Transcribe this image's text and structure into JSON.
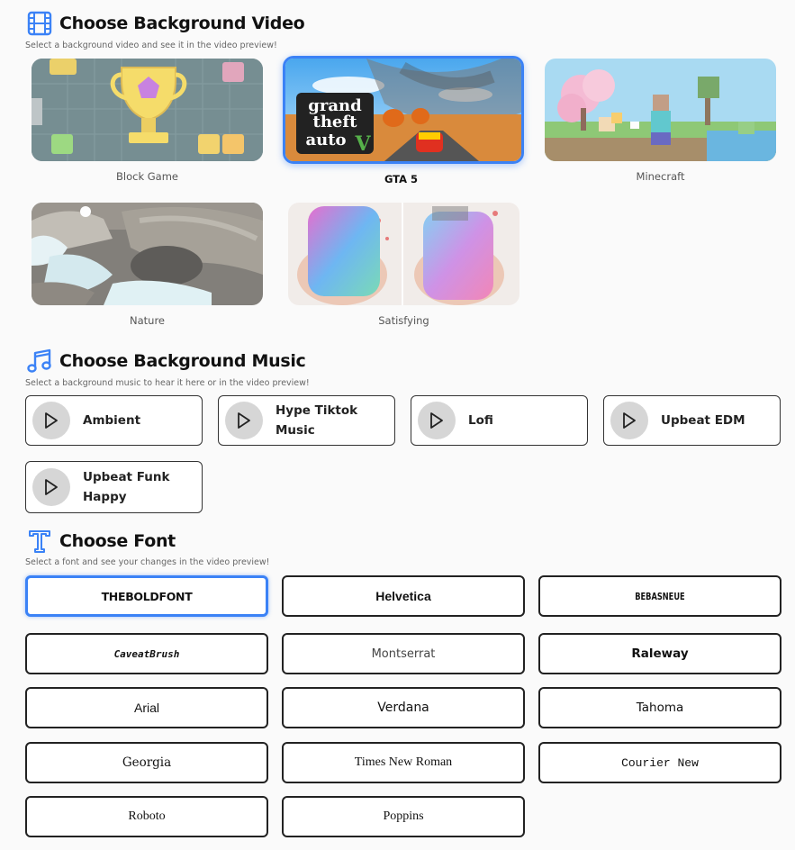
{
  "video_section": {
    "title": "Choose Background Video",
    "subtitle": "Select a background video and see it in the video preview!",
    "icon": "film-icon",
    "videos": [
      {
        "label": "Block Game",
        "selected": false
      },
      {
        "label": "GTA 5",
        "selected": true
      },
      {
        "label": "Minecraft",
        "selected": false
      },
      {
        "label": "Nature",
        "selected": false
      },
      {
        "label": "Satisfying",
        "selected": false
      }
    ],
    "gta_logo": [
      "grand",
      "theft",
      "auto",
      "V"
    ]
  },
  "music_section": {
    "title": "Choose Background Music",
    "subtitle": "Select a background music to hear it here or in the video preview!",
    "icon": "music-note-icon",
    "tracks": [
      {
        "label": "Ambient"
      },
      {
        "label": "Hype Tiktok Music"
      },
      {
        "label": "Lofi"
      },
      {
        "label": "Upbeat EDM"
      },
      {
        "label_line1": "Upbeat Funk",
        "label_line2": "Happy"
      }
    ]
  },
  "font_section": {
    "title": "Choose Font",
    "subtitle": "Select a font and see your changes in the video preview!",
    "icon": "text-t-icon",
    "fonts": [
      {
        "label": "THEBOLDFONT",
        "selected": true
      },
      {
        "label": "Helvetica"
      },
      {
        "label": "BEBASNEUE"
      },
      {
        "label": "CaveatBrush"
      },
      {
        "label": "Montserrat"
      },
      {
        "label": "Raleway"
      },
      {
        "label": "Arial"
      },
      {
        "label": "Verdana"
      },
      {
        "label": "Tahoma"
      },
      {
        "label": "Georgia"
      },
      {
        "label": "Times New Roman"
      },
      {
        "label": "Courier New"
      },
      {
        "label": "Roboto"
      },
      {
        "label": "Poppins"
      }
    ]
  },
  "colors": {
    "accent": "#3b82f6",
    "border": "#222222",
    "play_bg": "#d6d6d6"
  }
}
